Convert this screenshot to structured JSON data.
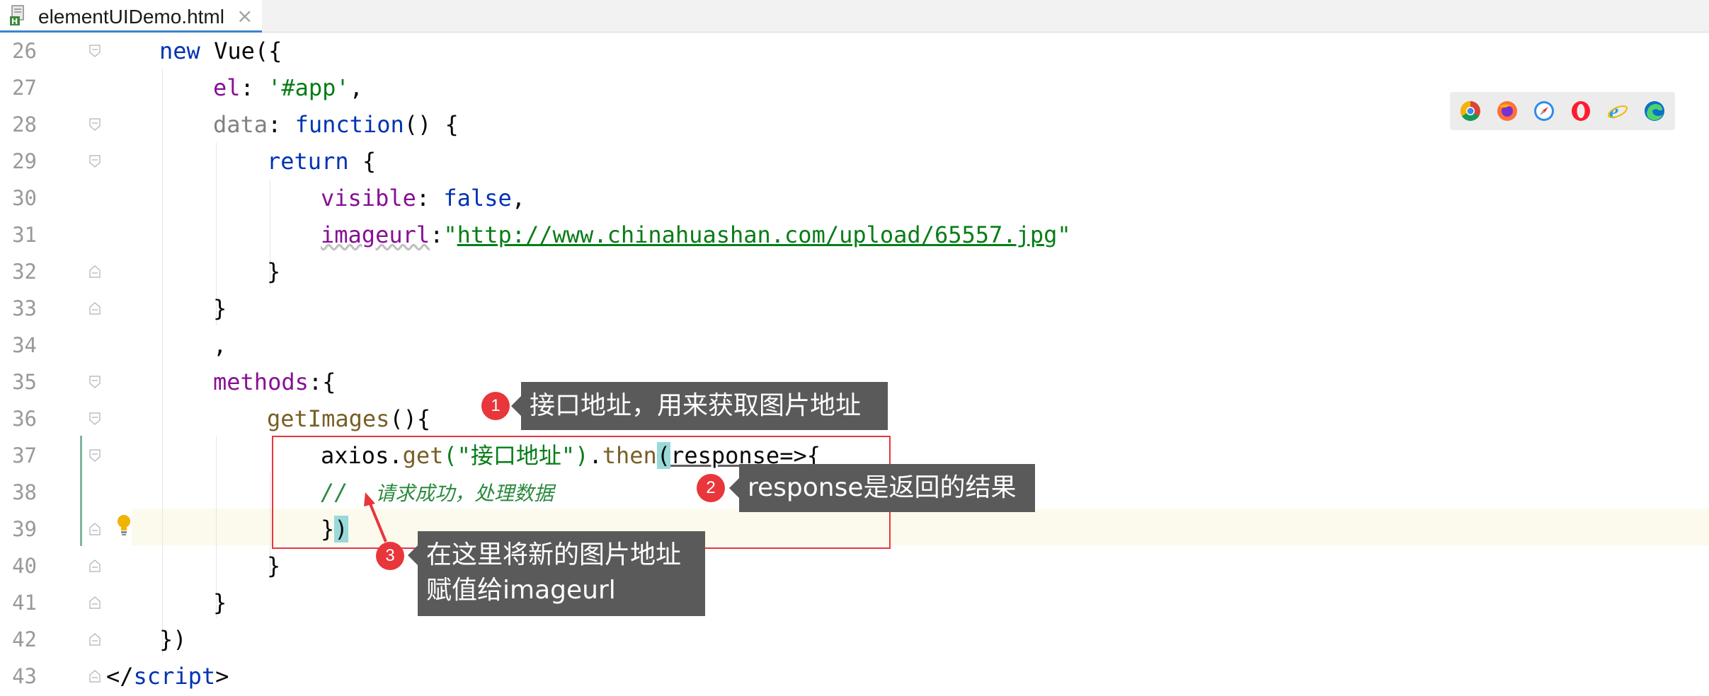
{
  "tab": {
    "title": "elementUIDemo.html",
    "close_icon": "×",
    "icon": "html-file-icon"
  },
  "editor": {
    "lines": [
      {
        "num": "26"
      },
      {
        "num": "27"
      },
      {
        "num": "28"
      },
      {
        "num": "29"
      },
      {
        "num": "30"
      },
      {
        "num": "31"
      },
      {
        "num": "32"
      },
      {
        "num": "33"
      },
      {
        "num": "34"
      },
      {
        "num": "35"
      },
      {
        "num": "36"
      },
      {
        "num": "37"
      },
      {
        "num": "38"
      },
      {
        "num": "39"
      },
      {
        "num": "40"
      },
      {
        "num": "41"
      },
      {
        "num": "42"
      },
      {
        "num": "43"
      }
    ],
    "code": {
      "l26": {
        "kw": "new",
        "rest": " Vue({"
      },
      "l27": {
        "prop": "el",
        "colon": ": ",
        "str": "'#app'",
        "tail": ","
      },
      "l28": {
        "prop": "data",
        "colon": ": ",
        "kw": "function",
        "tail": "() {"
      },
      "l29": {
        "kw": "return",
        "tail": " {"
      },
      "l30": {
        "prop": "visible",
        "colon": ": ",
        "kw": "false",
        "tail": ","
      },
      "l31": {
        "prop": "imageurl",
        "colon": ":",
        "q1": "\"",
        "url": "http://www.chinahuashan.com/upload/65557.jpg",
        "q2": "\""
      },
      "l32": {
        "text": "}"
      },
      "l33": {
        "text": "}"
      },
      "l34": {
        "text": ","
      },
      "l35": {
        "prop": "methods",
        "tail": ":{"
      },
      "l36": {
        "fn": "getImages",
        "tail": "(){"
      },
      "l37": {
        "obj": "axios.",
        "fn": "get",
        "str": "(\"接口地址\")",
        "dot": ".",
        "fn2": "then",
        "paren": "(",
        "param": "response",
        "tail": "=>{"
      },
      "l38": {
        "comment": "//  ",
        "comment_text": "请求成功，处理数据"
      },
      "l39": {
        "brace": "}",
        "paren": ")"
      },
      "l40": {
        "text": "}"
      },
      "l41": {
        "text": "}"
      },
      "l42": {
        "text": "})"
      },
      "l43": {
        "open": "</",
        "tag": "script",
        "close": ">"
      }
    }
  },
  "browsers": [
    "chrome-icon",
    "firefox-icon",
    "safari-icon",
    "opera-icon",
    "ie-icon",
    "edge-icon"
  ],
  "annotations": {
    "c1": {
      "badge": "1",
      "text": "接口地址，用来获取图片地址"
    },
    "c2": {
      "badge": "2",
      "text": "response是返回的结果"
    },
    "c3": {
      "badge": "3",
      "text_line1": "在这里将新的图片地址",
      "text_line2": "赋值给imageurl"
    }
  },
  "colors": {
    "keyword": "#0033b3",
    "property": "#871094",
    "string": "#067d17",
    "function": "#795e26",
    "annotation_red": "#e8363b",
    "callout_bg": "#5a5a5a",
    "bracket_highlight": "#99d9d9"
  }
}
